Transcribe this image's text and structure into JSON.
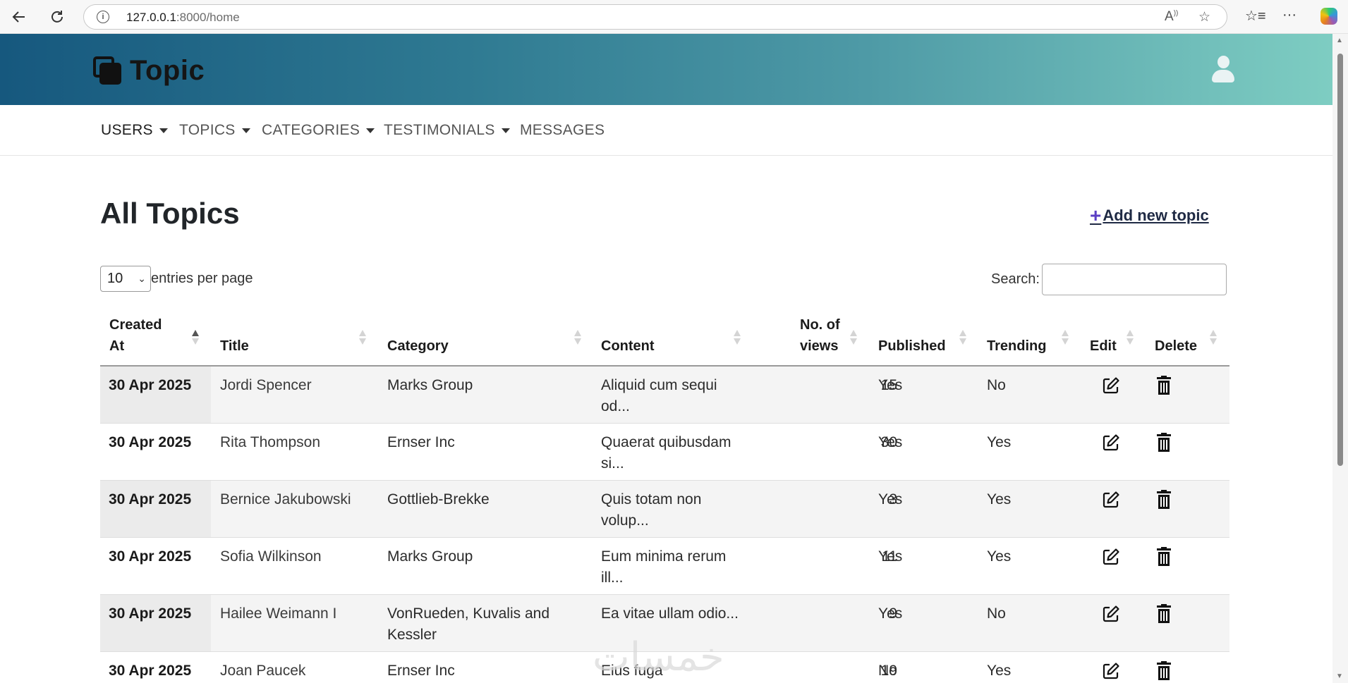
{
  "browser": {
    "url_host": "127.0.0.1",
    "url_path": ":8000/home"
  },
  "header": {
    "logo_text": "Topic"
  },
  "menu": {
    "items": [
      {
        "label": "USERS",
        "dropdown": true
      },
      {
        "label": "TOPICS",
        "dropdown": true
      },
      {
        "label": "CATEGORIES",
        "dropdown": true
      },
      {
        "label": "TESTIMONIALS",
        "dropdown": true
      },
      {
        "label": "MESSAGES",
        "dropdown": false
      }
    ]
  },
  "main": {
    "title": "All Topics",
    "add_link": "Add new topic",
    "entries_value": "10",
    "entries_label": "entries per page",
    "search_label": "Search:",
    "search_value": ""
  },
  "table": {
    "columns": [
      {
        "line1": "Created",
        "line2": "At"
      },
      {
        "line1": "",
        "line2": "Title"
      },
      {
        "line1": "",
        "line2": "Category"
      },
      {
        "line1": "",
        "line2": "Content"
      },
      {
        "line1": "No. of",
        "line2": "views"
      },
      {
        "line1": "",
        "line2": "Published"
      },
      {
        "line1": "",
        "line2": "Trending"
      },
      {
        "line1": "",
        "line2": "Edit"
      },
      {
        "line1": "",
        "line2": "Delete"
      }
    ],
    "rows": [
      {
        "created": "30 Apr 2025",
        "title": "Jordi Spencer",
        "category_1": "Marks Group",
        "category_2": "",
        "content_1": "Aliquid cum sequi",
        "content_2": "od...",
        "views": "15",
        "published": "Yes",
        "trending": "No"
      },
      {
        "created": "30 Apr 2025",
        "title": "Rita Thompson",
        "category_1": "Ernser Inc",
        "category_2": "",
        "content_1": "Quaerat quibusdam",
        "content_2": "si...",
        "views": "30",
        "published": "Yes",
        "trending": "Yes"
      },
      {
        "created": "30 Apr 2025",
        "title": "Bernice Jakubowski",
        "category_1": "Gottlieb-Brekke",
        "category_2": "",
        "content_1": "Quis totam non",
        "content_2": "volup...",
        "views": "3",
        "published": "Yes",
        "trending": "Yes"
      },
      {
        "created": "30 Apr 2025",
        "title": "Sofia Wilkinson",
        "category_1": "Marks Group",
        "category_2": "",
        "content_1": "Eum minima rerum",
        "content_2": "ill...",
        "views": "11",
        "published": "Yes",
        "trending": "Yes"
      },
      {
        "created": "30 Apr 2025",
        "title": "Hailee Weimann I",
        "category_1": "VonRueden, Kuvalis and",
        "category_2": "Kessler",
        "content_1": "Ea vitae ullam odio...",
        "content_2": "",
        "views": "9",
        "published": "Yes",
        "trending": "No"
      },
      {
        "created": "30 Apr 2025",
        "title": "Joan Paucek",
        "category_1": "Ernser Inc",
        "category_2": "",
        "content_1": "Eius fuga",
        "content_2": "",
        "views": "19",
        "published": "No",
        "trending": "Yes"
      }
    ]
  },
  "watermark": "خمسات"
}
